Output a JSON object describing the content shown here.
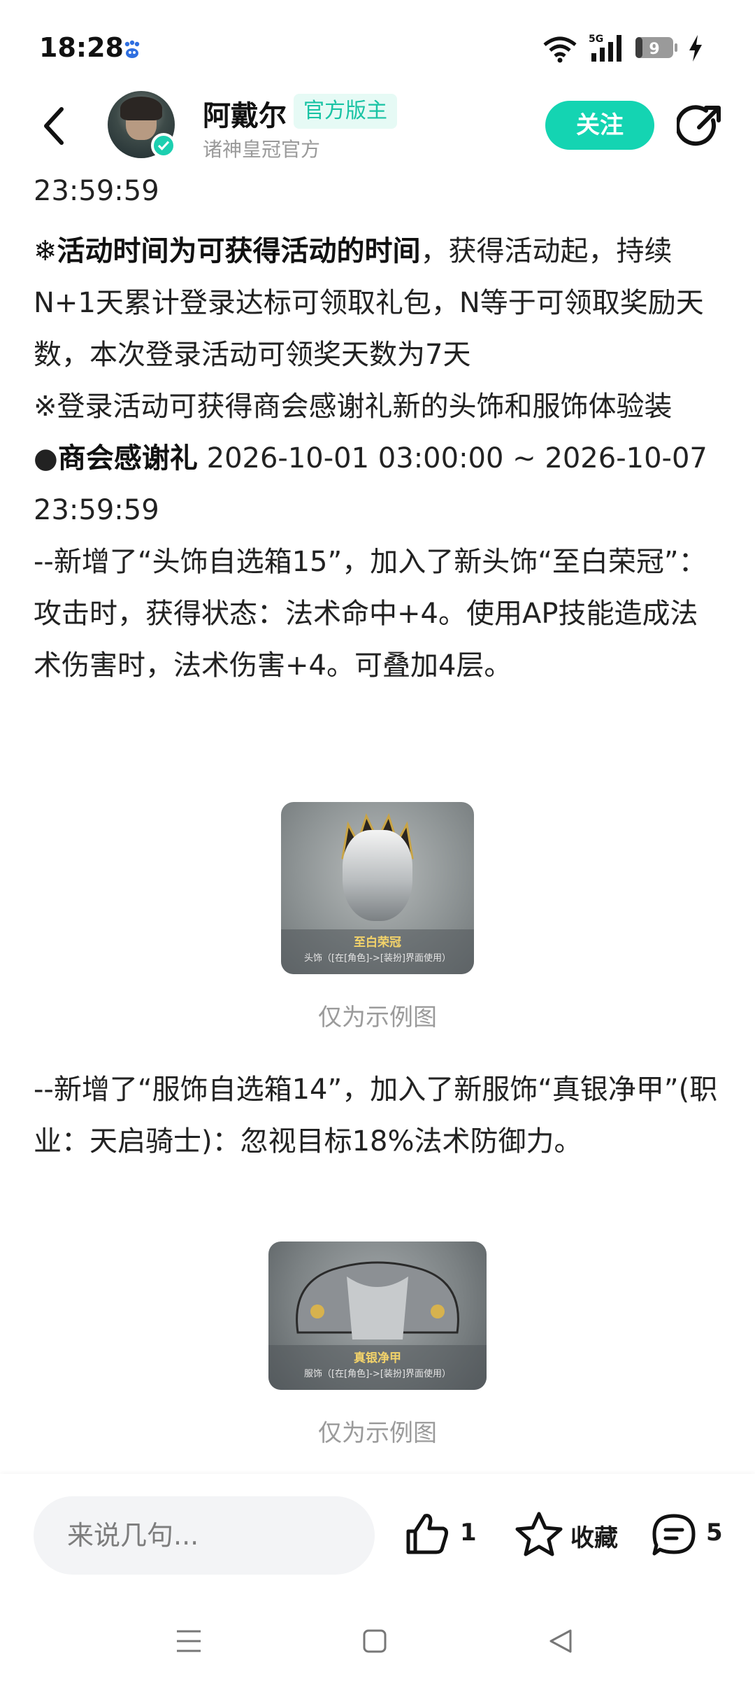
{
  "status_bar": {
    "time": "18:28",
    "network": "5G",
    "battery": "9"
  },
  "header": {
    "author_name": "阿戴尔",
    "role_badge": "官方版主",
    "author_sub": "诸神皇冠官方",
    "follow_label": "关注"
  },
  "article": {
    "cutoff_line": "23:59:59",
    "note1_bold": "❄活动时间为可获得活动的时间",
    "note1_rest": "，获得活动起，持续N+1天累计登录达标可领取礼包，N等于可领取奖励天数，本次登录活动可领奖天数为7天",
    "note2": "※登录活动可获得商会感谢礼新的头饰和服饰体验装",
    "section_bullet": "●",
    "section_title": "商会感谢礼",
    "section_time": " 2026-10-01 03:00:00 ~ 2026-10-07 23:59:59",
    "item1": " --新增了“头饰自选箱15”，加入了新头饰“至白荣冠”：攻击时，获得状态：法术命中+4。使用AP技能造成法术伤害时，法术伤害+4。可叠加4层。",
    "fig1_title": "至白荣冠",
    "fig1_sub": "头饰（[在[角色]->[装扮]界面使用）",
    "fig1_caption": "仅为示例图",
    "item2": " --新增了“服饰自选箱14”，加入了新服饰“真银净甲”(职业：天启骑士)：忽视目标18%法术防御力。",
    "fig2_title": "真银净甲",
    "fig2_sub": "服饰（[在[角色]->[装扮]界面使用）",
    "fig2_caption": "仅为示例图"
  },
  "bottom_bar": {
    "comment_placeholder": "来说几句...",
    "like_count": "1",
    "favorite_label": "收藏",
    "comment_count": "5"
  },
  "colors": {
    "accent": "#14d4b2",
    "badge_bg": "#e6faf5",
    "badge_text": "#19c3a4",
    "caption_gray": "#9b9b9b"
  }
}
